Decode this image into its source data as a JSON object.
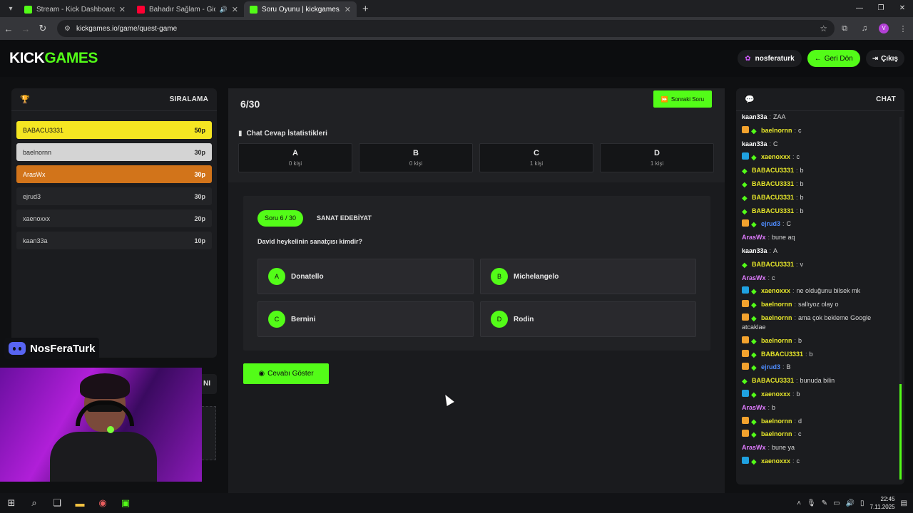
{
  "browser": {
    "tabs": [
      {
        "title": "Stream - Kick Dashboard",
        "favicon_color": "#53fc18",
        "active": false
      },
      {
        "title": "Bahadır Sağlam - Gidiyor G",
        "favicon_color": "#ff0033",
        "active": false,
        "audio": true
      },
      {
        "title": "Soru Oyunu | kickgames.io",
        "favicon_color": "#53fc18",
        "active": true
      }
    ],
    "url": "kickgames.io/game/quest-game",
    "profile_initial": "V"
  },
  "header": {
    "logo_part1": "KICK",
    "logo_part2": "GAMES",
    "username": "nosferaturk",
    "back_label": "Geri Dön",
    "exit_label": "Çıkış"
  },
  "ranking": {
    "title": "SIRALAMA",
    "rows": [
      {
        "name": "BABACU3331",
        "points": "50p",
        "tier": "gold"
      },
      {
        "name": "baelnornn",
        "points": "30p",
        "tier": "silver"
      },
      {
        "name": "ArasWx",
        "points": "30p",
        "tier": "bronze"
      },
      {
        "name": "ejrud3",
        "points": "30p",
        "tier": ""
      },
      {
        "name": "xaenoxxx",
        "points": "20p",
        "tier": ""
      },
      {
        "name": "kaan33a",
        "points": "10p",
        "tier": ""
      }
    ]
  },
  "overlay": {
    "discord_name": "NosFeraTurk",
    "peek_text": "NI"
  },
  "game": {
    "progress": "6/30",
    "next_label": "Sonraki Soru",
    "stats_title": "Chat Cevap İstatistikleri",
    "stats": [
      {
        "letter": "A",
        "count": "0 kişi"
      },
      {
        "letter": "B",
        "count": "0 kişi"
      },
      {
        "letter": "C",
        "count": "1 kişi"
      },
      {
        "letter": "D",
        "count": "1 kişi"
      }
    ],
    "question_badge": "Soru 6 / 30",
    "category": "SANAT EDEBİYAT",
    "question": "David heykelinin sanatçısı kimdir?",
    "options": [
      {
        "letter": "A",
        "text": "Donatello"
      },
      {
        "letter": "B",
        "text": "Michelangelo"
      },
      {
        "letter": "C",
        "text": "Bernini"
      },
      {
        "letter": "D",
        "text": "Rodin"
      }
    ],
    "reveal_label": "Cevabı Göster"
  },
  "chat": {
    "title": "CHAT",
    "colors": {
      "yellow": "#e6e62a",
      "white": "#ffffff",
      "blue": "#4f8dff",
      "pink": "#e07cff",
      "green": "#53fc18"
    },
    "messages": [
      {
        "user": "kaan33a",
        "color": "#ffffff",
        "badges": [],
        "text": "ZAA"
      },
      {
        "user": "baelnornn",
        "color": "#e6e62a",
        "badges": [
          "sub",
          "vip"
        ],
        "text": "c"
      },
      {
        "user": "kaan33a",
        "color": "#ffffff",
        "badges": [],
        "text": "C"
      },
      {
        "user": "xaenoxxx",
        "color": "#e6e62a",
        "badges": [
          "mod",
          "vip"
        ],
        "text": "c"
      },
      {
        "user": "BABACU3331",
        "color": "#e6e62a",
        "badges": [
          "vip"
        ],
        "text": "b"
      },
      {
        "user": "BABACU3331",
        "color": "#e6e62a",
        "badges": [
          "vip"
        ],
        "text": "b"
      },
      {
        "user": "BABACU3331",
        "color": "#e6e62a",
        "badges": [
          "vip"
        ],
        "text": "b"
      },
      {
        "user": "BABACU3331",
        "color": "#e6e62a",
        "badges": [
          "vip"
        ],
        "text": "b"
      },
      {
        "user": "ejrud3",
        "color": "#4f8dff",
        "badges": [
          "sub",
          "vip"
        ],
        "text": "C"
      },
      {
        "user": "ArasWx",
        "color": "#e07cff",
        "badges": [],
        "text": "bune aq"
      },
      {
        "user": "kaan33a",
        "color": "#ffffff",
        "badges": [],
        "text": "A"
      },
      {
        "user": "BABACU3331",
        "color": "#e6e62a",
        "badges": [
          "vip"
        ],
        "text": "v"
      },
      {
        "user": "ArasWx",
        "color": "#e07cff",
        "badges": [],
        "text": "c"
      },
      {
        "user": "xaenoxxx",
        "color": "#e6e62a",
        "badges": [
          "mod",
          "vip"
        ],
        "text": "ne olduğunu bilsek mk"
      },
      {
        "user": "baelnornn",
        "color": "#e6e62a",
        "badges": [
          "sub",
          "vip"
        ],
        "text": "sallıyoz olay o"
      },
      {
        "user": "baelnornn",
        "color": "#e6e62a",
        "badges": [
          "sub",
          "vip"
        ],
        "text": "ama çok bekleme Google atcaklae"
      },
      {
        "user": "baelnornn",
        "color": "#e6e62a",
        "badges": [
          "sub",
          "vip"
        ],
        "text": "b"
      },
      {
        "user": "BABACU3331",
        "color": "#e6e62a",
        "badges": [
          "sub",
          "vip"
        ],
        "text": "b"
      },
      {
        "user": "ejrud3",
        "color": "#4f8dff",
        "badges": [
          "sub",
          "vip"
        ],
        "text": "B"
      },
      {
        "user": "BABACU3331",
        "color": "#e6e62a",
        "badges": [
          "vip"
        ],
        "text": "bunuda bilin"
      },
      {
        "user": "xaenoxxx",
        "color": "#e6e62a",
        "badges": [
          "mod",
          "vip"
        ],
        "text": "b"
      },
      {
        "user": "ArasWx",
        "color": "#e07cff",
        "badges": [],
        "text": "b"
      },
      {
        "user": "baelnornn",
        "color": "#e6e62a",
        "badges": [
          "sub",
          "vip"
        ],
        "text": "d"
      },
      {
        "user": "baelnornn",
        "color": "#e6e62a",
        "badges": [
          "sub",
          "vip"
        ],
        "text": "c"
      },
      {
        "user": "ArasWx",
        "color": "#e07cff",
        "badges": [],
        "text": "bune ya"
      },
      {
        "user": "xaenoxxx",
        "color": "#e6e62a",
        "badges": [
          "mod",
          "vip"
        ],
        "text": "c"
      }
    ]
  },
  "taskbar": {
    "time": "22:45",
    "date": "7.11.2025"
  }
}
